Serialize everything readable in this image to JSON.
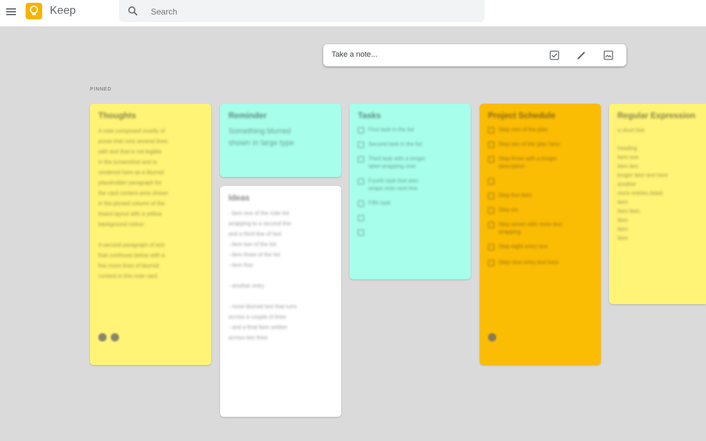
{
  "header": {
    "app_title": "Keep",
    "search_placeholder": "Search",
    "menu_icon": "menu-icon",
    "logo_icon": "keep-bulb-icon",
    "search_icon": "search-icon"
  },
  "take_note": {
    "placeholder": "Take a note...",
    "buttons": [
      "new-list-icon",
      "draw-icon",
      "image-icon"
    ]
  },
  "section": {
    "pinned_label": "PINNED"
  },
  "colors": {
    "yellow": "#fff475",
    "teal": "#a7ffeb",
    "orange": "#fbbc04",
    "white": "#ffffff",
    "background": "#dadada"
  },
  "notes": [
    {
      "title": "Thoughts",
      "body": "A note composed mostly of\nprose that runs several lines\nwith text that is not legible\nin the screenshot and is\nrendered here as a blurred\nplaceholder paragraph for\nthe card content area shown\nin the pinned column of the\nboard layout with a yellow\nbackground colour.\n\nA second paragraph of text\nthat continues below with a\nfew more lines of blurred\ncontent in this note card."
    },
    {
      "title": "Reminder",
      "body": "Something blurred\nshown in large type"
    },
    {
      "title": "Ideas",
      "body": "- item one of the note list\n  wrapping to a second line\n  and a third line of text\n- item two of the list\n- item three of the list\n- item four\n\n- another entry\n\n- more blurred text that runs\n  across a couple of lines\n- and a final item written\n  across two lines"
    },
    {
      "title": "Tasks",
      "items": [
        "First task in the list",
        "Second task in the list",
        "Third task with a longer\nlabel wrapping over",
        "Fourth task that also\nwraps onto next line",
        "Fifth task",
        "",
        ""
      ]
    },
    {
      "title": "Project Schedule",
      "items": [
        "Step one of the plan",
        "Step two of the plan here",
        "Step three with a longer\ndescription",
        "",
        "Step five item",
        "Step six",
        "Step seven with more text\nwrapping",
        "Step eight entry text",
        "Step nine entry text here"
      ]
    },
    {
      "title": "Regular Expression",
      "body": "a short line\n\nheading\n  item one\n  item two\n  longer item text here\nanother\n  more entries listed\n  item\n  item item\n  item\n  item\n  item"
    }
  ]
}
